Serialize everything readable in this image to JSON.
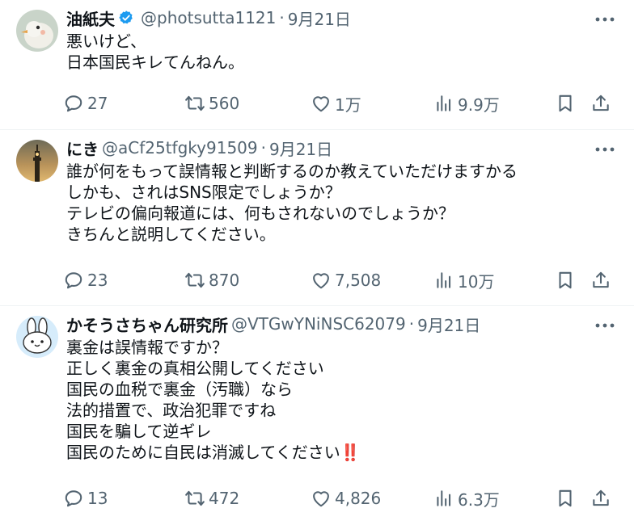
{
  "tweets": [
    {
      "name": "油紙夫",
      "verified": true,
      "handle": "@photsutta1121",
      "separator": "·",
      "date": "9月21日",
      "lines": [
        "悪いけど、",
        "日本国民キレてんねん。"
      ],
      "stats": {
        "replies": "27",
        "retweets": "560",
        "likes": "1万",
        "views": "9.9万"
      },
      "avatar": "bird-avatar"
    },
    {
      "name": "にき",
      "verified": false,
      "handle": "@aCf25tfgky91509",
      "separator": "·",
      "date": "9月21日",
      "lines": [
        "誰が何をもって誤情報と判断するのか教えていただけますかる",
        "しかも、されはSNS限定でしょうか？",
        "テレビの偏向報道には、何もされないのでしょうか？",
        "きちんと説明してください。"
      ],
      "stats": {
        "replies": "23",
        "retweets": "870",
        "likes": "7,508",
        "views": "10万"
      },
      "avatar": "tower-photo-avatar"
    },
    {
      "name": "かそうさちゃん研究所",
      "verified": false,
      "handle": "@VTGwYNiNSC62079",
      "separator": "·",
      "date": "9月21日",
      "lines": [
        "裏金は誤情報ですか？",
        "正しく裏金の真相公開してください",
        "国民の血税で裏金（汚職）なら",
        "法的措置で、政治犯罪ですね",
        "国民を騙して逆ギレ",
        "国民のために自民は消滅してください"
      ],
      "last_line_emoji": "‼️",
      "stats": {
        "replies": "13",
        "retweets": "472",
        "likes": "4,826",
        "views": "6.3万"
      },
      "avatar": "rabbit-avatar"
    }
  ],
  "colors": {
    "text": "#0f1419",
    "muted": "#536471",
    "verified": "#1d9bf0",
    "divider": "#eff3f4",
    "emoji_red": "#e0161e"
  },
  "icons": [
    "reply-icon",
    "retweet-icon",
    "like-icon",
    "views-icon",
    "bookmark-icon",
    "share-icon",
    "more-icon",
    "verified-icon"
  ]
}
